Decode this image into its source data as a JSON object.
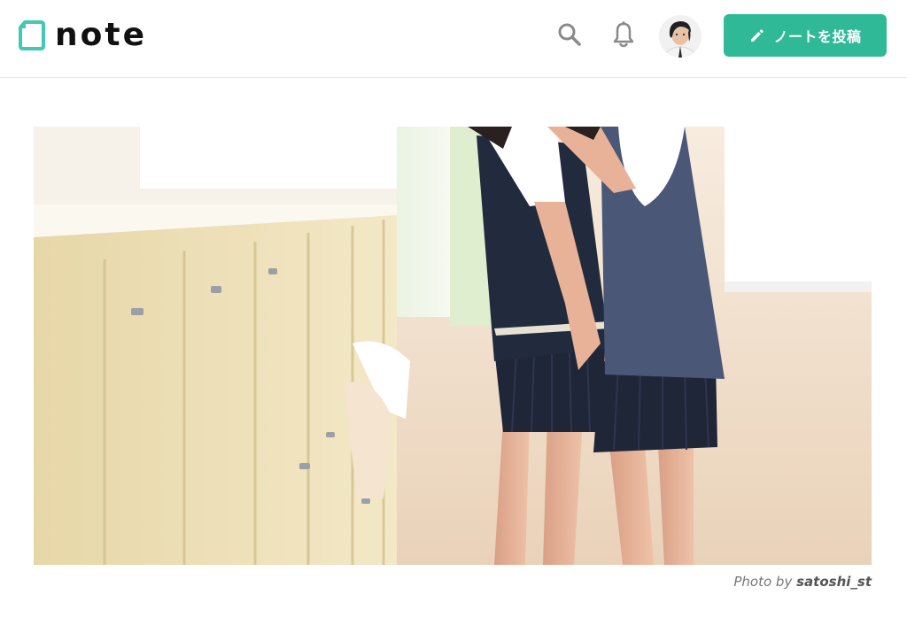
{
  "header": {
    "logo_text": "note",
    "post_button_label": "ノートを投稿",
    "icons": {
      "search": "search-icon",
      "notifications": "bell-icon",
      "compose": "pencil-icon"
    },
    "accent_color": "#2fb997"
  },
  "hero": {
    "credit_prefix": "Photo by",
    "credit_author": "satoshi_st"
  }
}
